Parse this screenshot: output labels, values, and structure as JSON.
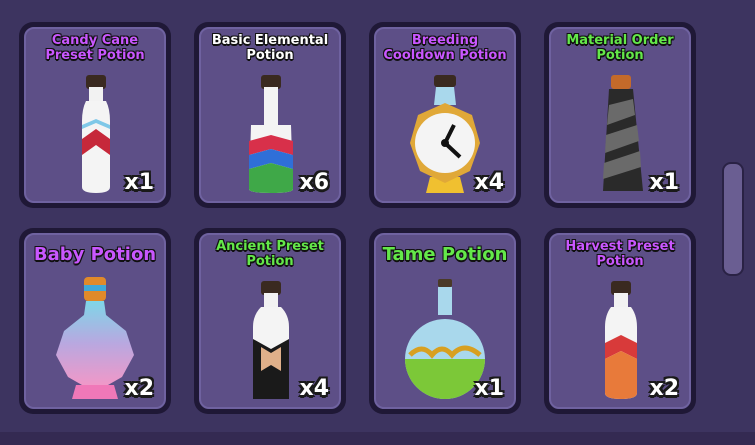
{
  "inventory": {
    "items": [
      {
        "name": "Candy Cane Preset Potion",
        "qty": "x1",
        "name_color": "#c957ff",
        "icon": "candy-cane-bottle"
      },
      {
        "name": "Basic Elemental Potion",
        "qty": "x6",
        "name_color": "#ffffff",
        "icon": "elemental-bottle"
      },
      {
        "name": "Breeding Cooldown Potion",
        "qty": "x4",
        "name_color": "#c957ff",
        "icon": "clock-bottle"
      },
      {
        "name": "Material Order Potion",
        "qty": "x1",
        "name_color": "#64e84a",
        "icon": "twisted-black-bottle"
      },
      {
        "name": "Baby Potion",
        "qty": "x2",
        "name_color": "#c957ff",
        "icon": "rainbow-flask"
      },
      {
        "name": "Ancient Preset Potion",
        "qty": "x4",
        "name_color": "#64e84a",
        "icon": "ancient-bottle"
      },
      {
        "name": "Tame Potion",
        "qty": "x1",
        "name_color": "#64e84a",
        "icon": "round-flask"
      },
      {
        "name": "Harvest Preset Potion",
        "qty": "x2",
        "name_color": "#c957ff",
        "icon": "harvest-bottle"
      }
    ]
  }
}
